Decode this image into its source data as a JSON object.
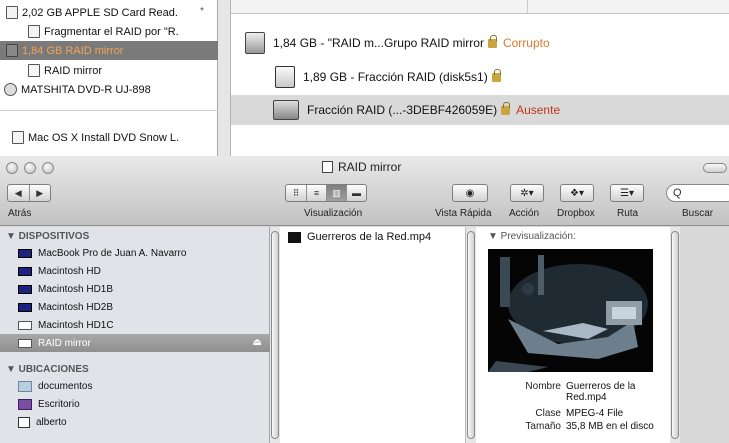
{
  "disk_utility": {
    "list": [
      {
        "label": "2,02 GB APPLE SD Card Read.",
        "icon": "sd-card-icon"
      },
      {
        "label": "Fragmentar el RAID por \"R.",
        "icon": "partition-icon"
      },
      {
        "label": "1,84 GB RAID mirror",
        "icon": "raid-icon"
      },
      {
        "label": "RAID mirror",
        "icon": "volume-icon"
      },
      {
        "label": "MATSHITA DVD-R UJ-898",
        "icon": "dvd-icon"
      },
      {
        "label": "Mac OS X Install DVD Snow L.",
        "icon": "dvd-disk-icon"
      }
    ],
    "mark": "*",
    "raid_set": [
      {
        "label": "1,84 GB - \"RAID m...Grupo RAID mirror",
        "status": "Corrupto"
      },
      {
        "label": "1,89 GB - Fracción RAID (disk5s1)",
        "status": ""
      },
      {
        "label": "Fracción RAID (...-3DEBF426059E)",
        "status": "Ausente"
      }
    ]
  },
  "finder": {
    "title": "RAID mirror",
    "nav": {
      "back": "◀",
      "forward": "▶",
      "label": "Atrás"
    },
    "view_buttons": [
      "⠿",
      "≡",
      "▥",
      "▬"
    ],
    "toolbar": {
      "view_label": "Visualización",
      "quicklook_label": "Vista Rápida",
      "action_label": "Acción",
      "dropbox_label": "Dropbox",
      "path_label": "Ruta",
      "search_label": "Buscar",
      "search_value": "Q"
    },
    "sidebar": {
      "devices_header": "▼ DISPOSITIVOS",
      "devices": [
        "MacBook Pro de Juan A. Navarro",
        "Macintosh HD",
        "Macintosh HD1B",
        "Macintosh HD2B",
        "Macintosh HD1C",
        "RAID mirror"
      ],
      "eject": "⏏",
      "places_header": "▼ UBICACIONES",
      "places": [
        "documentos",
        "Escritorio",
        "alberto"
      ]
    },
    "files": [
      "Guerreros de la Red.mp4"
    ],
    "preview": {
      "title": "▼ Previsualización:",
      "meta": [
        {
          "key": "Nombre",
          "value": "Guerreros de la Red.mp4"
        },
        {
          "key": "Clase",
          "value": "MPEG-4 File"
        },
        {
          "key": "Tamaño",
          "value": "35,8 MB en el disco"
        }
      ]
    }
  },
  "colors": {
    "status_red": "#c0351e",
    "selected_orange": "#d9772d",
    "sidebar_bg": "#e0e4e9"
  }
}
